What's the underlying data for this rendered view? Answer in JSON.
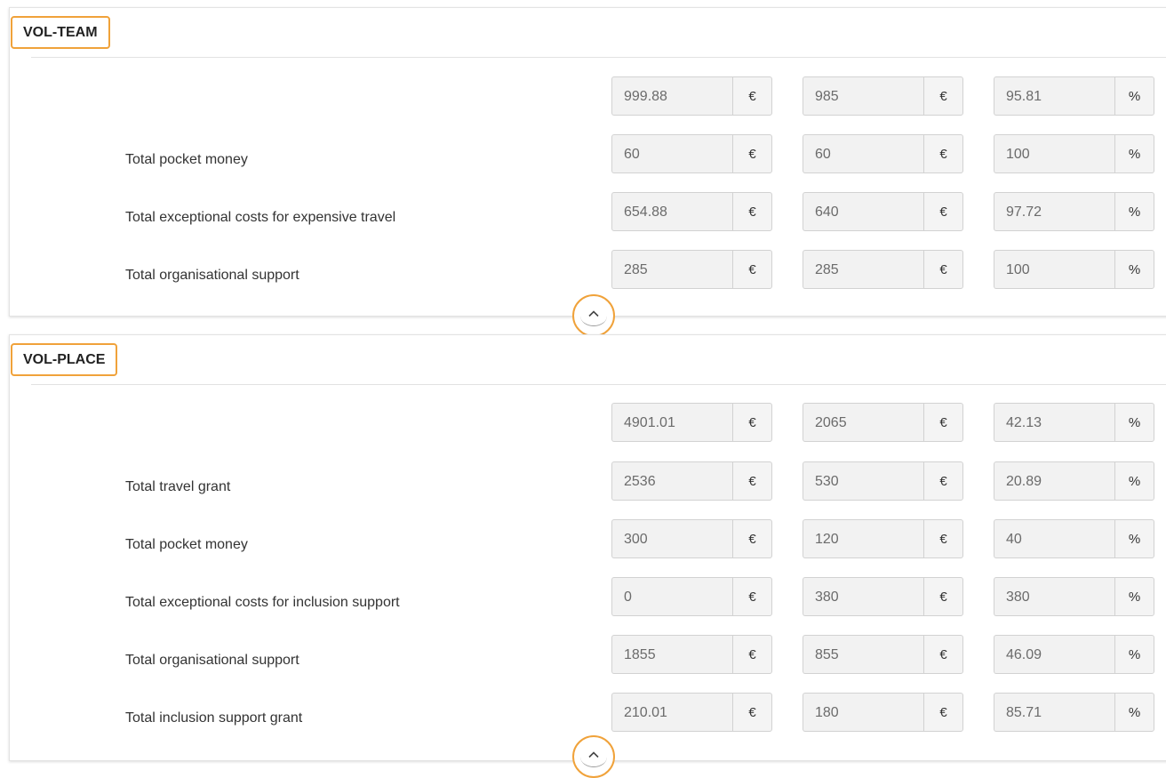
{
  "sections": [
    {
      "tag": "VOL-TEAM",
      "rows": [
        {
          "label": "",
          "v1": "999.88",
          "u1": "€",
          "v2": "985",
          "u2": "€",
          "v3": "95.81",
          "u3": "%"
        },
        {
          "label": "Total pocket money",
          "v1": "60",
          "u1": "€",
          "v2": "60",
          "u2": "€",
          "v3": "100",
          "u3": "%"
        },
        {
          "label": "Total exceptional costs for expensive travel",
          "v1": "654.88",
          "u1": "€",
          "v2": "640",
          "u2": "€",
          "v3": "97.72",
          "u3": "%"
        },
        {
          "label": "Total organisational support",
          "v1": "285",
          "u1": "€",
          "v2": "285",
          "u2": "€",
          "v3": "100",
          "u3": "%"
        }
      ]
    },
    {
      "tag": "VOL-PLACE",
      "rows": [
        {
          "label": "",
          "v1": "4901.01",
          "u1": "€",
          "v2": "2065",
          "u2": "€",
          "v3": "42.13",
          "u3": "%"
        },
        {
          "label": "Total travel grant",
          "v1": "2536",
          "u1": "€",
          "v2": "530",
          "u2": "€",
          "v3": "20.89",
          "u3": "%"
        },
        {
          "label": "Total pocket money",
          "v1": "300",
          "u1": "€",
          "v2": "120",
          "u2": "€",
          "v3": "40",
          "u3": "%"
        },
        {
          "label": "Total exceptional costs for inclusion support",
          "v1": "0",
          "u1": "€",
          "v2": "380",
          "u2": "€",
          "v3": "380",
          "u3": "%"
        },
        {
          "label": "Total organisational support",
          "v1": "1855",
          "u1": "€",
          "v2": "855",
          "u2": "€",
          "v3": "46.09",
          "u3": "%"
        },
        {
          "label": "Total inclusion support grant",
          "v1": "210.01",
          "u1": "€",
          "v2": "180",
          "u2": "€",
          "v3": "85.71",
          "u3": "%"
        }
      ]
    }
  ],
  "icons": {
    "collapse": "chevron-up-icon"
  },
  "colors": {
    "accent": "#f0a23a",
    "input_bg": "#f2f2f2",
    "input_border": "#d2d2d2"
  }
}
